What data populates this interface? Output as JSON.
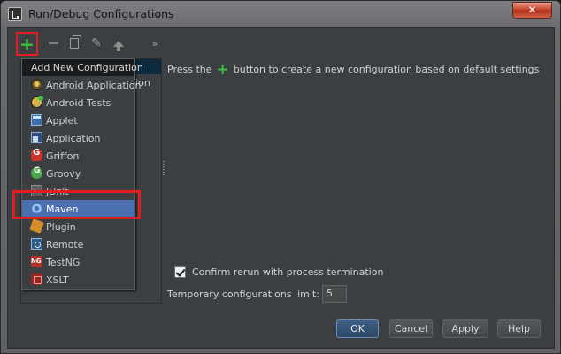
{
  "window": {
    "title": "Run/Debug Configurations",
    "close_glyph": "✕"
  },
  "toolbar": {
    "add_icon": "plus-icon",
    "remove_icon": "minus-icon",
    "copy_icon": "copy-icon",
    "settings_icon": "wrench-icon",
    "move_up_icon": "arrow-up-icon",
    "more_glyph": "»"
  },
  "tree": {
    "partial_label": "ation"
  },
  "popup": {
    "title": "Add New Configuration",
    "items": [
      {
        "label": "Android Application",
        "icon": "android-application-icon"
      },
      {
        "label": "Android Tests",
        "icon": "android-tests-icon"
      },
      {
        "label": "Applet",
        "icon": "applet-icon"
      },
      {
        "label": "Application",
        "icon": "application-icon"
      },
      {
        "label": "Griffon",
        "icon": "griffon-icon"
      },
      {
        "label": "Groovy",
        "icon": "groovy-icon"
      },
      {
        "label": "JUnit",
        "icon": "junit-icon"
      },
      {
        "label": "Maven",
        "icon": "maven-icon",
        "selected": true
      },
      {
        "label": "Plugin",
        "icon": "plugin-icon"
      },
      {
        "label": "Remote",
        "icon": "remote-icon"
      },
      {
        "label": "TestNG",
        "icon": "testng-icon"
      },
      {
        "label": "XSLT",
        "icon": "xslt-icon"
      }
    ]
  },
  "hint": {
    "before": "Press the",
    "plus": "+",
    "after": "button to create a new configuration based on default settings"
  },
  "settings": {
    "confirm_rerun_label": "Confirm rerun with process termination",
    "confirm_rerun_checked": true,
    "temp_limit_label": "Temporary configurations limit:",
    "temp_limit_value": "5"
  },
  "buttons": {
    "ok": "OK",
    "cancel": "Cancel",
    "apply": "Apply",
    "help": "Help"
  },
  "colors": {
    "highlight_red": "#e21d1d",
    "selection_blue": "#4b6eaf",
    "plus_green": "#3ec23e",
    "panel_bg": "#3c3f41"
  }
}
